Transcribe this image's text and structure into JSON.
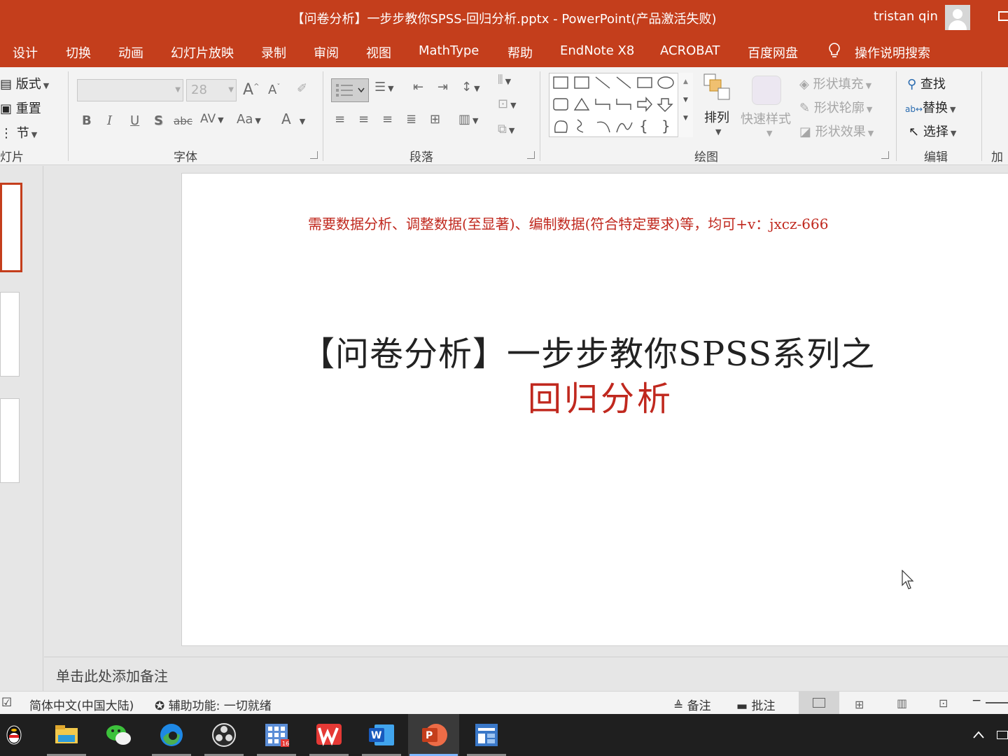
{
  "window": {
    "title": "【问卷分析】一步步教你SPSS-回归分析.pptx  -  PowerPoint(产品激活失败)",
    "user": "tristan qin"
  },
  "menu": {
    "tabs": [
      "设计",
      "切换",
      "动画",
      "幻灯片放映",
      "录制",
      "审阅",
      "视图",
      "MathType",
      "帮助",
      "EndNote X8",
      "ACROBAT",
      "百度网盘"
    ],
    "search_help": "操作说明搜索"
  },
  "ribbon": {
    "slides_group": {
      "layout": "版式",
      "reset": "重置",
      "section": "节",
      "label": "灯片"
    },
    "font_group": {
      "label": "字体",
      "font_name": "",
      "font_size": "28",
      "bold": "B",
      "italic": "I",
      "underline": "U",
      "shadow": "S",
      "strike": "abc",
      "spacing": "AV",
      "case": "Aa",
      "font_color": "A",
      "grow": "A",
      "shrink": "A"
    },
    "paragraph_group": {
      "label": "段落"
    },
    "drawing_group": {
      "label": "绘图",
      "arrange": "排列",
      "quick_styles": "快速样式",
      "shape_fill": "形状填充",
      "shape_outline": "形状轮廓",
      "shape_effects": "形状效果"
    },
    "editing_group": {
      "label": "编辑",
      "find": "查找",
      "replace": "替换",
      "select": "选择"
    },
    "addins_group": {
      "label": "加载"
    }
  },
  "slide": {
    "subtitle": "需要数据分析、调整数据(至显著)、编制数据(符合特定要求)等，均可+v：jxcz-666",
    "title_line1": "【问卷分析】一步步教你SPSS系列之",
    "title_line2": "回归分析"
  },
  "notes": {
    "placeholder": "单击此处添加备注"
  },
  "statusbar": {
    "language": "简体中文(中国大陆)",
    "accessibility": "辅助功能: 一切就绪",
    "notes_btn": "备注",
    "comments_btn": "批注"
  },
  "taskbar": {
    "apps": [
      "qq-icon",
      "file-explorer-icon",
      "wechat-icon",
      "edge-icon",
      "obs-icon",
      "calendar-app-icon",
      "wps-icon",
      "word-icon",
      "powerpoint-icon",
      "generic-app-icon"
    ],
    "active_app": "powerpoint-icon",
    "calendar_badge": "16"
  },
  "colors": {
    "accent": "#c43e1c",
    "slide_red": "#c0281e",
    "taskbar": "#1f1f1f"
  }
}
